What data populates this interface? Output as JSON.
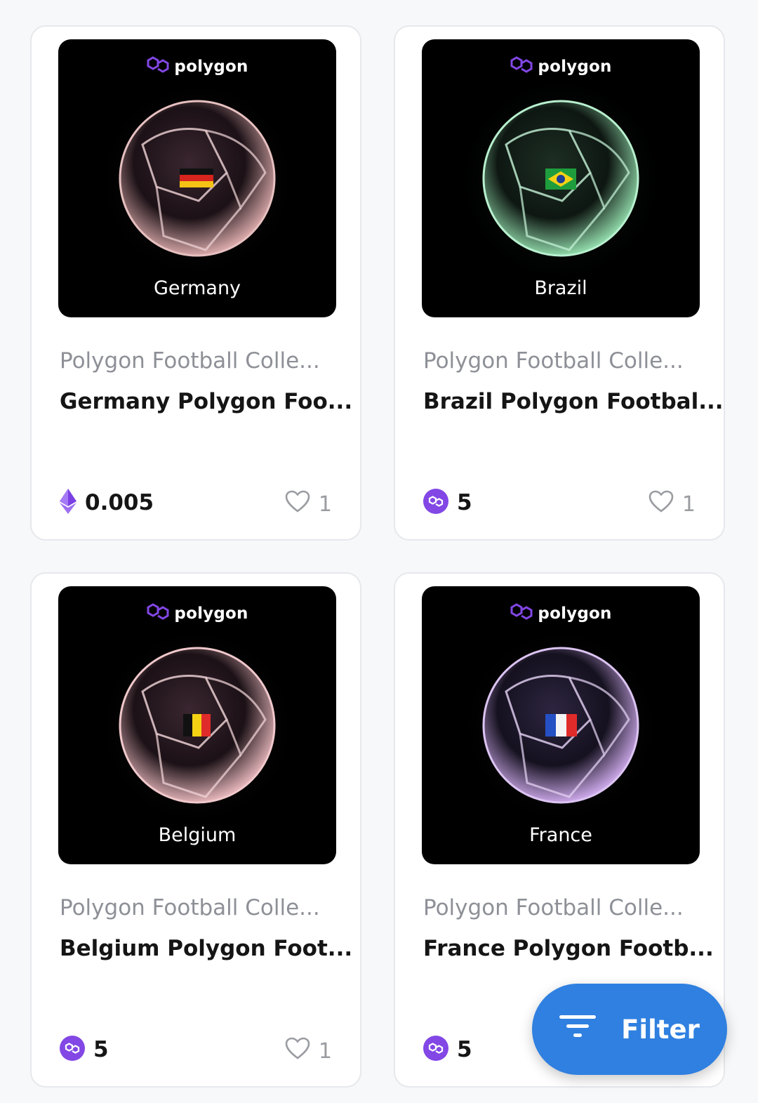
{
  "cards": [
    {
      "country": "Germany",
      "brand": "polygon",
      "collection": "Polygon Football Colle...",
      "name": "Germany Polygon Foo...",
      "price": "0.005",
      "price_icon": "ethereum-icon",
      "likes": "1"
    },
    {
      "country": "Brazil",
      "brand": "polygon",
      "collection": "Polygon Football Colle...",
      "name": "Brazil Polygon Footbal...",
      "price": "5",
      "price_icon": "polygon-matic-icon",
      "likes": "1"
    },
    {
      "country": "Belgium",
      "brand": "polygon",
      "collection": "Polygon Football Colle...",
      "name": "Belgium Polygon Foot...",
      "price": "5",
      "price_icon": "polygon-matic-icon",
      "likes": "1"
    },
    {
      "country": "France",
      "brand": "polygon",
      "collection": "Polygon Football Colle...",
      "name": "France Polygon Footb...",
      "price": "5",
      "price_icon": "polygon-matic-icon",
      "likes": ""
    }
  ],
  "filter": {
    "label": "Filter",
    "icon": "filter-icon"
  },
  "colors": {
    "polygon_purple": "#8247e5",
    "filter_blue": "#2f80e0",
    "card_border": "#e6e8ec"
  }
}
